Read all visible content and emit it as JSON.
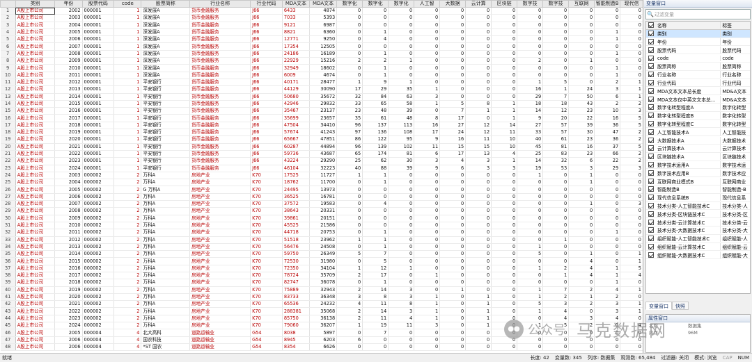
{
  "grid": {
    "columns": [
      "类别",
      "年份",
      "股票代码",
      "code",
      "股票简称",
      "行业名称",
      "行业代码",
      "MDA文本",
      "MDA文本",
      "数字化",
      "数字化",
      "数字化",
      "人工智",
      "大数据",
      "云计算",
      "区块链",
      "数字技",
      "数字技",
      "互联网",
      "智能制造B",
      "现代信"
    ],
    "rows": [
      [
        "1",
        "A股上市公司",
        "2002",
        "000001",
        "1",
        "深发展A",
        "货币金融服务",
        "J66",
        "6433",
        "4874",
        "0",
        "0",
        "0",
        "0",
        "0",
        "0",
        "0",
        "0",
        "0",
        "0",
        "0",
        "0"
      ],
      [
        "2",
        "A股上市公司",
        "2003",
        "000001",
        "1",
        "深发展A",
        "货币金融服务",
        "J66",
        "7033",
        "5393",
        "0",
        "0",
        "0",
        "0",
        "0",
        "0",
        "0",
        "0",
        "0",
        "0",
        "0",
        "0"
      ],
      [
        "3",
        "A股上市公司",
        "2004",
        "000001",
        "1",
        "深发展A",
        "货币金融服务",
        "J66",
        "9121",
        "6987",
        "0",
        "0",
        "0",
        "0",
        "0",
        "0",
        "0",
        "0",
        "0",
        "0",
        "0",
        "0"
      ],
      [
        "4",
        "A股上市公司",
        "2005",
        "000001",
        "1",
        "深发展A",
        "货币金融服务",
        "J66",
        "8821",
        "6360",
        "0",
        "1",
        "0",
        "0",
        "0",
        "0",
        "0",
        "0",
        "0",
        "0",
        "1",
        "0"
      ],
      [
        "5",
        "A股上市公司",
        "2006",
        "000001",
        "1",
        "深发展A",
        "货币金融服务",
        "J66",
        "12771",
        "9250",
        "0",
        "4",
        "0",
        "0",
        "0",
        "0",
        "0",
        "0",
        "0",
        "0",
        "1",
        "0"
      ],
      [
        "6",
        "A股上市公司",
        "2007",
        "000001",
        "1",
        "深发展A",
        "货币金融服务",
        "J66",
        "17354",
        "12505",
        "0",
        "0",
        "0",
        "0",
        "0",
        "0",
        "0",
        "0",
        "0",
        "0",
        "0",
        "0"
      ],
      [
        "7",
        "A股上市公司",
        "2008",
        "000001",
        "1",
        "深发展A",
        "货币金融服务",
        "J66",
        "24186",
        "16189",
        "0",
        "1",
        "0",
        "0",
        "0",
        "0",
        "0",
        "0",
        "0",
        "0",
        "1",
        "0"
      ],
      [
        "8",
        "A股上市公司",
        "2009",
        "000001",
        "1",
        "深发展A",
        "货币金融服务",
        "J66",
        "22929",
        "15216",
        "2",
        "2",
        "1",
        "0",
        "0",
        "0",
        "0",
        "2",
        "0",
        "1",
        "0",
        "0"
      ],
      [
        "9",
        "A股上市公司",
        "2010",
        "000001",
        "1",
        "深发展A",
        "货币金融服务",
        "J66",
        "32949",
        "18602",
        "0",
        "1",
        "0",
        "0",
        "0",
        "0",
        "0",
        "0",
        "0",
        "0",
        "1",
        "0"
      ],
      [
        "10",
        "A股上市公司",
        "2011",
        "000001",
        "1",
        "深发展A",
        "货币金融服务",
        "J66",
        "6009",
        "4674",
        "0",
        "1",
        "0",
        "0",
        "0",
        "0",
        "0",
        "0",
        "0",
        "0",
        "1",
        "0"
      ],
      [
        "11",
        "A股上市公司",
        "2012",
        "000001",
        "1",
        "平安银行",
        "货币金融服务",
        "J66",
        "40171",
        "28477",
        "1",
        "9",
        "1",
        "0",
        "0",
        "0",
        "0",
        "1",
        "5",
        "0",
        "2",
        "1"
      ],
      [
        "12",
        "A股上市公司",
        "2013",
        "000001",
        "1",
        "平安银行",
        "货币金融服务",
        "J66",
        "44129",
        "30090",
        "17",
        "29",
        "35",
        "1",
        "0",
        "0",
        "0",
        "16",
        "1",
        "24",
        "3",
        "1"
      ],
      [
        "13",
        "A股上市公司",
        "2014",
        "000001",
        "1",
        "平安银行",
        "货币金融服务",
        "J66",
        "50680",
        "35672",
        "32",
        "84",
        "63",
        "3",
        "0",
        "0",
        "0",
        "29",
        "7",
        "50",
        "6",
        "1"
      ],
      [
        "14",
        "A股上市公司",
        "2015",
        "000001",
        "1",
        "平安银行",
        "货币金融服务",
        "J66",
        "42946",
        "29832",
        "33",
        "65",
        "58",
        "1",
        "5",
        "8",
        "1",
        "18",
        "18",
        "43",
        "2",
        "2"
      ],
      [
        "15",
        "A股上市公司",
        "2016",
        "000001",
        "1",
        "平安银行",
        "货币金融服务",
        "J66",
        "35467",
        "23137",
        "23",
        "48",
        "39",
        "0",
        "7",
        "1",
        "1",
        "14",
        "12",
        "23",
        "10",
        "3"
      ],
      [
        "16",
        "A股上市公司",
        "2017",
        "000001",
        "1",
        "平安银行",
        "货币金融服务",
        "J66",
        "35699",
        "23657",
        "35",
        "61",
        "48",
        "8",
        "17",
        "0",
        "1",
        "9",
        "20",
        "22",
        "16",
        "5"
      ],
      [
        "17",
        "A股上市公司",
        "2018",
        "000001",
        "1",
        "平安银行",
        "货币金融服务",
        "J66",
        "47504",
        "34410",
        "96",
        "137",
        "113",
        "16",
        "27",
        "12",
        "14",
        "27",
        "57",
        "39",
        "36",
        "5"
      ],
      [
        "18",
        "A股上市公司",
        "2019",
        "000001",
        "1",
        "平安银行",
        "货币金融服务",
        "J66",
        "57674",
        "41243",
        "97",
        "136",
        "108",
        "17",
        "24",
        "12",
        "11",
        "33",
        "57",
        "30",
        "47",
        "2"
      ],
      [
        "19",
        "A股上市公司",
        "2020",
        "000001",
        "1",
        "平安银行",
        "货币金融服务",
        "J66",
        "65667",
        "47851",
        "86",
        "122",
        "95",
        "9",
        "16",
        "11",
        "10",
        "40",
        "61",
        "23",
        "36",
        "2"
      ],
      [
        "20",
        "A股上市公司",
        "2021",
        "000001",
        "1",
        "平安银行",
        "货币金融服务",
        "J66",
        "60287",
        "44894",
        "96",
        "139",
        "102",
        "11",
        "15",
        "15",
        "10",
        "45",
        "81",
        "16",
        "37",
        "5"
      ],
      [
        "21",
        "A股上市公司",
        "2022",
        "000001",
        "1",
        "平安银行",
        "货币金融服务",
        "J66",
        "59736",
        "43687",
        "65",
        "174",
        "81",
        "6",
        "17",
        "13",
        "4",
        "25",
        "83",
        "23",
        "66",
        "2"
      ],
      [
        "22",
        "A股上市公司",
        "2023",
        "000001",
        "1",
        "平安银行",
        "货币金融服务",
        "J66",
        "43224",
        "29290",
        "25",
        "62",
        "30",
        "3",
        "4",
        "3",
        "1",
        "14",
        "32",
        "6",
        "22",
        "2"
      ],
      [
        "23",
        "A股上市公司",
        "2024",
        "000001",
        "1",
        "平安银行",
        "货币金融服务",
        "J66",
        "46104",
        "32223",
        "40",
        "88",
        "39",
        "9",
        "6",
        "3",
        "3",
        "19",
        "53",
        "3",
        "29",
        "3"
      ],
      [
        "24",
        "A股上市公司",
        "2003",
        "000002",
        "2",
        "万科A",
        "房地产业",
        "K70",
        "17525",
        "11727",
        "1",
        "1",
        "0",
        "0",
        "0",
        "0",
        "0",
        "1",
        "0",
        "1",
        "0",
        "0"
      ],
      [
        "25",
        "A股上市公司",
        "2004",
        "000002",
        "2",
        "万科A",
        "房地产业",
        "K70",
        "18762",
        "11700",
        "0",
        "1",
        "0",
        "0",
        "0",
        "0",
        "0",
        "0",
        "0",
        "1",
        "0",
        "0"
      ],
      [
        "26",
        "A股上市公司",
        "2005",
        "000002",
        "2",
        "G 万科A",
        "房地产业",
        "K70",
        "24495",
        "13973",
        "0",
        "0",
        "0",
        "0",
        "0",
        "0",
        "0",
        "0",
        "0",
        "0",
        "0",
        "0"
      ],
      [
        "27",
        "A股上市公司",
        "2006",
        "000002",
        "2",
        "万科A",
        "房地产业",
        "K70",
        "36525",
        "16781",
        "0",
        "0",
        "0",
        "0",
        "0",
        "0",
        "0",
        "0",
        "0",
        "0",
        "0",
        "0"
      ],
      [
        "28",
        "A股上市公司",
        "2007",
        "000002",
        "2",
        "万科A",
        "房地产业",
        "K70",
        "37572",
        "19583",
        "0",
        "4",
        "0",
        "0",
        "0",
        "0",
        "0",
        "0",
        "0",
        "1",
        "0",
        "3"
      ],
      [
        "29",
        "A股上市公司",
        "2008",
        "000002",
        "2",
        "万科A",
        "房地产业",
        "K70",
        "38643",
        "20331",
        "0",
        "0",
        "0",
        "0",
        "0",
        "0",
        "0",
        "0",
        "0",
        "0",
        "0",
        "0"
      ],
      [
        "30",
        "A股上市公司",
        "2009",
        "000002",
        "2",
        "万科A",
        "房地产业",
        "K70",
        "39861",
        "20151",
        "0",
        "0",
        "0",
        "0",
        "0",
        "0",
        "0",
        "0",
        "0",
        "0",
        "0",
        "0"
      ],
      [
        "31",
        "A股上市公司",
        "2010",
        "000002",
        "2",
        "万科A",
        "房地产业",
        "K70",
        "45525",
        "21586",
        "0",
        "0",
        "0",
        "0",
        "0",
        "0",
        "0",
        "0",
        "0",
        "0",
        "0",
        "0"
      ],
      [
        "32",
        "A股上市公司",
        "2011",
        "000002",
        "2",
        "万科A",
        "房地产业",
        "K70",
        "44718",
        "20753",
        "0",
        "1",
        "0",
        "0",
        "0",
        "0",
        "0",
        "0",
        "0",
        "0",
        "1",
        "0"
      ],
      [
        "33",
        "A股上市公司",
        "2012",
        "000002",
        "2",
        "万科A",
        "房地产业",
        "K70",
        "51518",
        "23962",
        "1",
        "1",
        "0",
        "0",
        "0",
        "0",
        "0",
        "0",
        "1",
        "0",
        "0",
        "0"
      ],
      [
        "34",
        "A股上市公司",
        "2013",
        "000002",
        "2",
        "万科A",
        "房地产业",
        "K70",
        "56476",
        "24508",
        "0",
        "1",
        "0",
        "0",
        "0",
        "0",
        "0",
        "1",
        "0",
        "0",
        "0",
        "0"
      ],
      [
        "35",
        "A股上市公司",
        "2014",
        "000002",
        "2",
        "万科A",
        "房地产业",
        "K70",
        "59750",
        "26349",
        "5",
        "7",
        "0",
        "0",
        "0",
        "0",
        "0",
        "5",
        "0",
        "1",
        "0",
        "1"
      ],
      [
        "36",
        "A股上市公司",
        "2015",
        "000002",
        "2",
        "万科A",
        "房地产业",
        "K70",
        "72530",
        "31980",
        "0",
        "5",
        "0",
        "0",
        "0",
        "0",
        "0",
        "0",
        "0",
        "4",
        "0",
        "1"
      ],
      [
        "37",
        "A股上市公司",
        "2016",
        "000002",
        "2",
        "万科A",
        "房地产业",
        "K70",
        "72350",
        "34104",
        "1",
        "12",
        "1",
        "0",
        "0",
        "0",
        "0",
        "1",
        "2",
        "4",
        "1",
        "5"
      ],
      [
        "38",
        "A股上市公司",
        "2017",
        "000002",
        "2",
        "万科A",
        "房地产业",
        "K70",
        "78724",
        "35709",
        "2",
        "17",
        "0",
        "1",
        "0",
        "0",
        "0",
        "0",
        "1",
        "4",
        "1",
        "4"
      ],
      [
        "39",
        "A股上市公司",
        "2018",
        "000002",
        "2",
        "万科A",
        "房地产业",
        "K70",
        "82747",
        "36078",
        "0",
        "1",
        "0",
        "0",
        "0",
        "0",
        "0",
        "0",
        "0",
        "0",
        "1",
        "0"
      ],
      [
        "40",
        "A股上市公司",
        "2019",
        "000002",
        "2",
        "万科A",
        "房地产业",
        "K70",
        "75889",
        "32943",
        "2",
        "14",
        "3",
        "0",
        "1",
        "0",
        "0",
        "1",
        "7",
        "2",
        "4",
        "1"
      ],
      [
        "41",
        "A股上市公司",
        "2020",
        "000002",
        "2",
        "万科A",
        "房地产业",
        "K70",
        "83733",
        "36348",
        "3",
        "8",
        "3",
        "1",
        "0",
        "1",
        "0",
        "1",
        "2",
        "1",
        "2",
        "0"
      ],
      [
        "42",
        "A股上市公司",
        "2021",
        "000002",
        "2",
        "万科A",
        "房地产业",
        "K70",
        "65536",
        "24232",
        "4",
        "11",
        "8",
        "1",
        "0",
        "1",
        "0",
        "5",
        "3",
        "2",
        "3",
        "1"
      ],
      [
        "43",
        "A股上市公司",
        "2022",
        "000002",
        "2",
        "万科A",
        "房地产业",
        "K70",
        "288381",
        "35068",
        "2",
        "14",
        "3",
        "1",
        "0",
        "1",
        "0",
        "1",
        "4",
        "0",
        "3",
        "1"
      ],
      [
        "44",
        "A股上市公司",
        "2023",
        "000002",
        "2",
        "万科A",
        "房地产业",
        "K70",
        "85750",
        "36138",
        "2",
        "11",
        "4",
        "1",
        "0",
        "1",
        "0",
        "0",
        "4",
        "3",
        "4",
        "0"
      ],
      [
        "45",
        "A股上市公司",
        "2024",
        "000002",
        "2",
        "万科A",
        "房地产业",
        "K70",
        "79060",
        "36207",
        "1",
        "19",
        "11",
        "3",
        "0",
        "1",
        "0",
        "1",
        "5",
        "2",
        "0",
        "4"
      ],
      [
        "46",
        "A股上市公司",
        "2005",
        "000004",
        "4",
        "北大高科",
        "道路运输业",
        "G54",
        "8038",
        "5897",
        "0",
        "7",
        "0",
        "0",
        "0",
        "0",
        "0",
        "0",
        "0",
        "0",
        "0",
        "0"
      ],
      [
        "47",
        "A股上市公司",
        "2006",
        "000004",
        "4",
        "国农科技",
        "道路运输业",
        "G54",
        "8945",
        "6203",
        "6",
        "0",
        "0",
        "0",
        "0",
        "0",
        "0",
        "0",
        "0",
        "0",
        "0",
        "0"
      ],
      [
        "48",
        "A股上市公司",
        "2006",
        "000004",
        "4",
        "*ST 国农",
        "道路运输业",
        "G54",
        "8354",
        "6626",
        "0",
        "0",
        "0",
        "0",
        "0",
        "0",
        "0",
        "0",
        "0",
        "0",
        "0",
        "0"
      ]
    ]
  },
  "varwin": {
    "title": "变量窗口",
    "filter_placeholder": "过滤变量",
    "header": {
      "name": "名称",
      "label": "标签"
    },
    "items": [
      {
        "name": "类别",
        "label": "类别"
      },
      {
        "name": "年份",
        "label": "年份"
      },
      {
        "name": "股票代码",
        "label": "股票代码"
      },
      {
        "name": "code",
        "label": "code"
      },
      {
        "name": "股票简称",
        "label": "股票简称"
      },
      {
        "name": "行业名称",
        "label": "行业名称"
      },
      {
        "name": "行业代码",
        "label": "行业代码"
      },
      {
        "name": "MDA文本文本总长度",
        "label": "MD&A文本"
      },
      {
        "name": "MDA文本仅中英文文本总...",
        "label": "MD&A文本"
      },
      {
        "name": "数字化转型程度A",
        "label": "数字化转型"
      },
      {
        "name": "数字化转型程度B",
        "label": "数字化转型"
      },
      {
        "name": "数字化转型程度C",
        "label": "数字化转型"
      },
      {
        "name": "人工智能技术A",
        "label": "人工智能技"
      },
      {
        "name": "大数据技术A",
        "label": "大数据技术"
      },
      {
        "name": "云计算技术A",
        "label": "云计算技术"
      },
      {
        "name": "区块链技术A",
        "label": "区块链技术"
      },
      {
        "name": "数字技术运用A",
        "label": "数字技术运"
      },
      {
        "name": "数字技术应用B",
        "label": "数字技术应"
      },
      {
        "name": "互联网商业模式B",
        "label": "互联网商业"
      },
      {
        "name": "智能制造B",
        "label": "智能制造-B"
      },
      {
        "name": "现代信息系统B",
        "label": "现代信息系"
      },
      {
        "name": "技术分类-人工智能技术C",
        "label": "技术分类-人"
      },
      {
        "name": "技术分类-区块链技术C",
        "label": "技术分类-区"
      },
      {
        "name": "技术分类-云计算技术C",
        "label": "技术分类-云"
      },
      {
        "name": "技术分类-大数据技术C",
        "label": "技术分类-大"
      },
      {
        "name": "组织赋能-人工智能技术C",
        "label": "组织赋能-人"
      },
      {
        "name": "组织赋能-云计算技术C",
        "label": "组织赋能-云"
      },
      {
        "name": "组织赋能-大数据技术C",
        "label": "组织赋能-大"
      }
    ]
  },
  "tabs": [
    "变量窗口",
    "快照"
  ],
  "propwin": {
    "title": "属性窗口",
    "rows": [
      {
        "k": "名称",
        "v": "数据集"
      },
      {
        "k": "内存",
        "v": "96M"
      }
    ]
  },
  "status": {
    "left": "就绪",
    "length": "长度: 42",
    "vars": "变量数: 345",
    "order": "列序: 数据集",
    "obs": "观测数: 65,484",
    "filter": "过滤器: 关闭",
    "mode": "模式: 浏览",
    "cap": "CAP",
    "num": "NUM"
  },
  "watermark": {
    "brand": "公众号",
    "name": "马克数据网"
  }
}
